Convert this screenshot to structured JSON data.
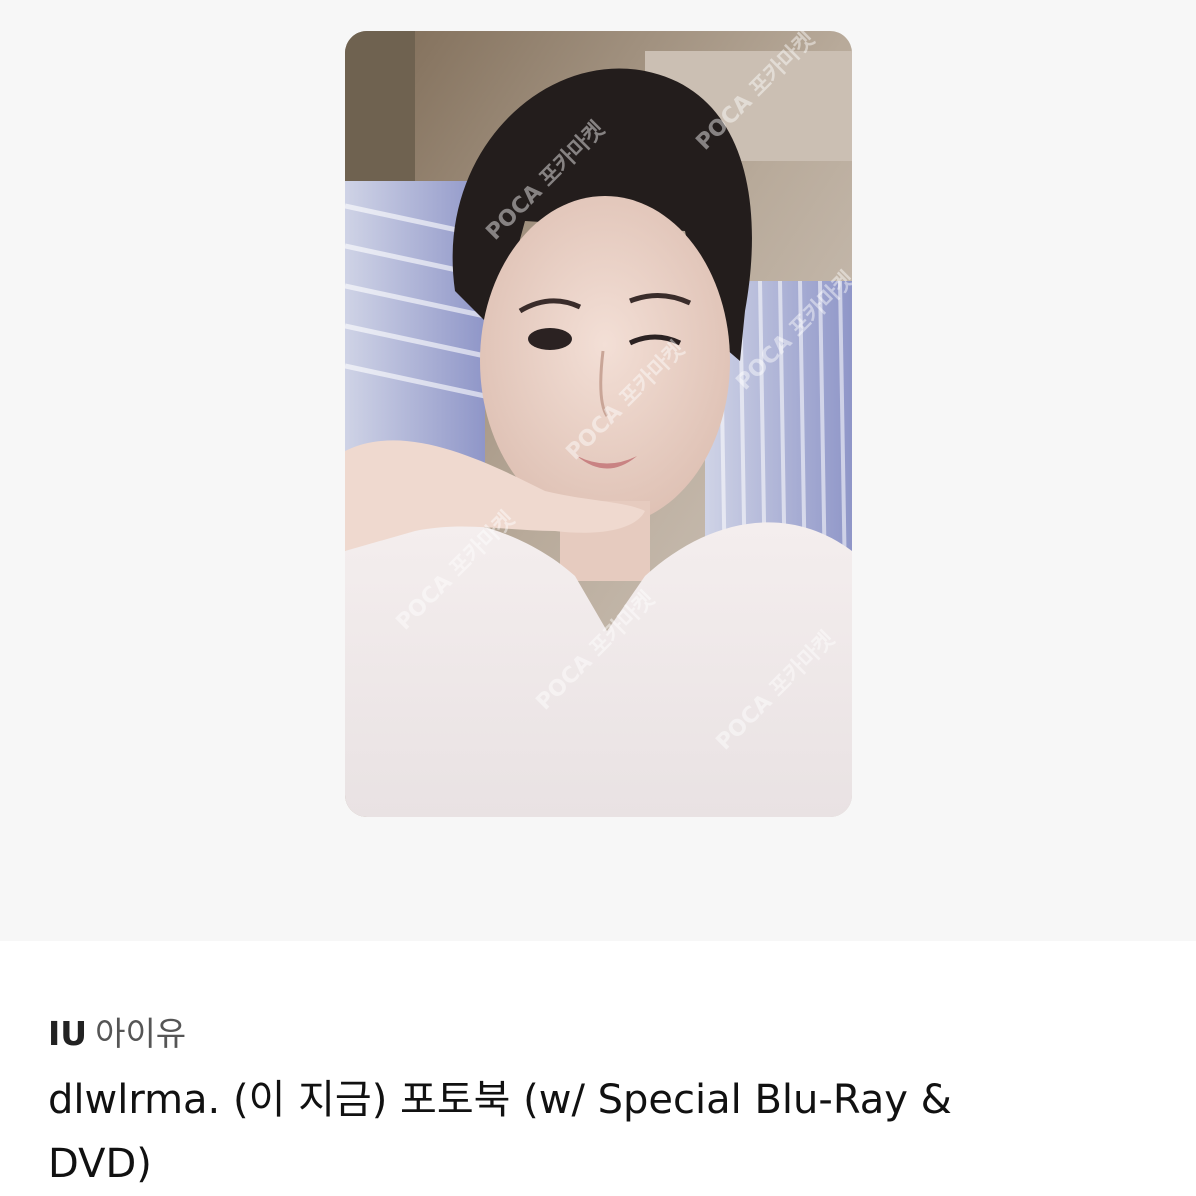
{
  "artist": {
    "name_en": "IU",
    "name_ko": "아이유"
  },
  "product": {
    "title": "dlwlrma. (이 지금) 포토북 (w/ Special Blu-Ray & DVD)"
  },
  "photocard": {
    "image": "photocard-photo",
    "watermark_text": "POCA 포카마켓"
  }
}
